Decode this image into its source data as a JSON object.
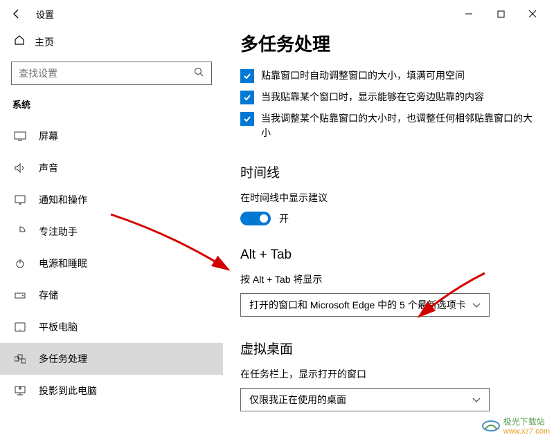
{
  "window": {
    "title": "设置"
  },
  "sidebar": {
    "home": "主页",
    "search_placeholder": "查找设置",
    "category": "系统",
    "items": [
      {
        "label": "屏幕"
      },
      {
        "label": "声音"
      },
      {
        "label": "通知和操作"
      },
      {
        "label": "专注助手"
      },
      {
        "label": "电源和睡眠"
      },
      {
        "label": "存储"
      },
      {
        "label": "平板电脑"
      },
      {
        "label": "多任务处理"
      },
      {
        "label": "投影到此电脑"
      }
    ]
  },
  "main": {
    "heading": "多任务处理",
    "checks": [
      "贴靠窗口时自动调整窗口的大小，填满可用空间",
      "当我贴靠某个窗口时，显示能够在它旁边贴靠的内容",
      "当我调整某个贴靠窗口的大小时，也调整任何相邻贴靠窗口的大小"
    ],
    "timeline": {
      "title": "时间线",
      "sub": "在时间线中显示建议",
      "toggle": "开"
    },
    "alttab": {
      "title": "Alt + Tab",
      "sub": "按 Alt + Tab 将显示",
      "value": "打开的窗口和 Microsoft Edge 中的 5 个最新选项卡"
    },
    "vdesktop": {
      "title": "虚拟桌面",
      "sub": "在任务栏上，显示打开的窗口",
      "value": "仅限我正在使用的桌面"
    }
  },
  "watermark": {
    "line1": "极光下载站",
    "line2": "www.xz7.com"
  }
}
